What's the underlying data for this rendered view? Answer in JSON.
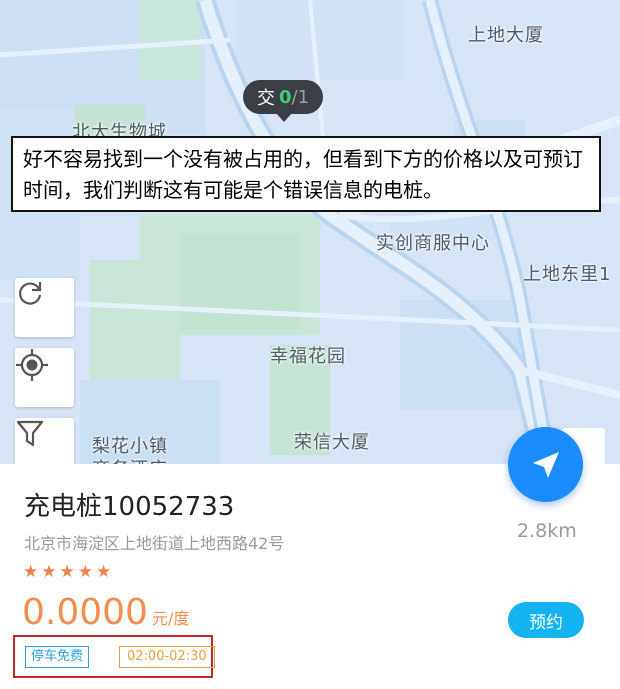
{
  "map": {
    "labels": {
      "shangdi_tower": "上地大厦",
      "beida_biocity": "北大生物城",
      "shichuang": "实创商服中心",
      "shangdi_dongli": "上地东里1",
      "xingfu_garden": "幸福花园",
      "rongxin_tower": "荣信大厦",
      "lihua_town": "梨花小镇",
      "business_hotel": "商务酒店"
    },
    "traffic_badge": {
      "label": "交",
      "count": "0",
      "total": "/1"
    }
  },
  "annotation": {
    "text": "好不容易找到一个没有被占用的，但看到下方的价格以及可预订时间，我们判断这有可能是个错误信息的电桩。"
  },
  "controls": {
    "icons": [
      "refresh-icon",
      "locate-icon",
      "filter-icon",
      "navigate-icon"
    ]
  },
  "station": {
    "name": "充电桩10052733",
    "address": "北京市海淀区上地街道上地西路42号",
    "distance": "2.8km",
    "rating": 5,
    "price": "0.0000",
    "unit": "元/度",
    "reserve_label": "预约",
    "tags": {
      "parking": "停车免费",
      "time": "02:00-02:30"
    }
  },
  "colors": {
    "accent": "#1a8cff",
    "price": "#f58d4e",
    "reserve": "#13b3f2",
    "highlight_box": "#c6262e",
    "traffic_green": "#38d07a"
  }
}
